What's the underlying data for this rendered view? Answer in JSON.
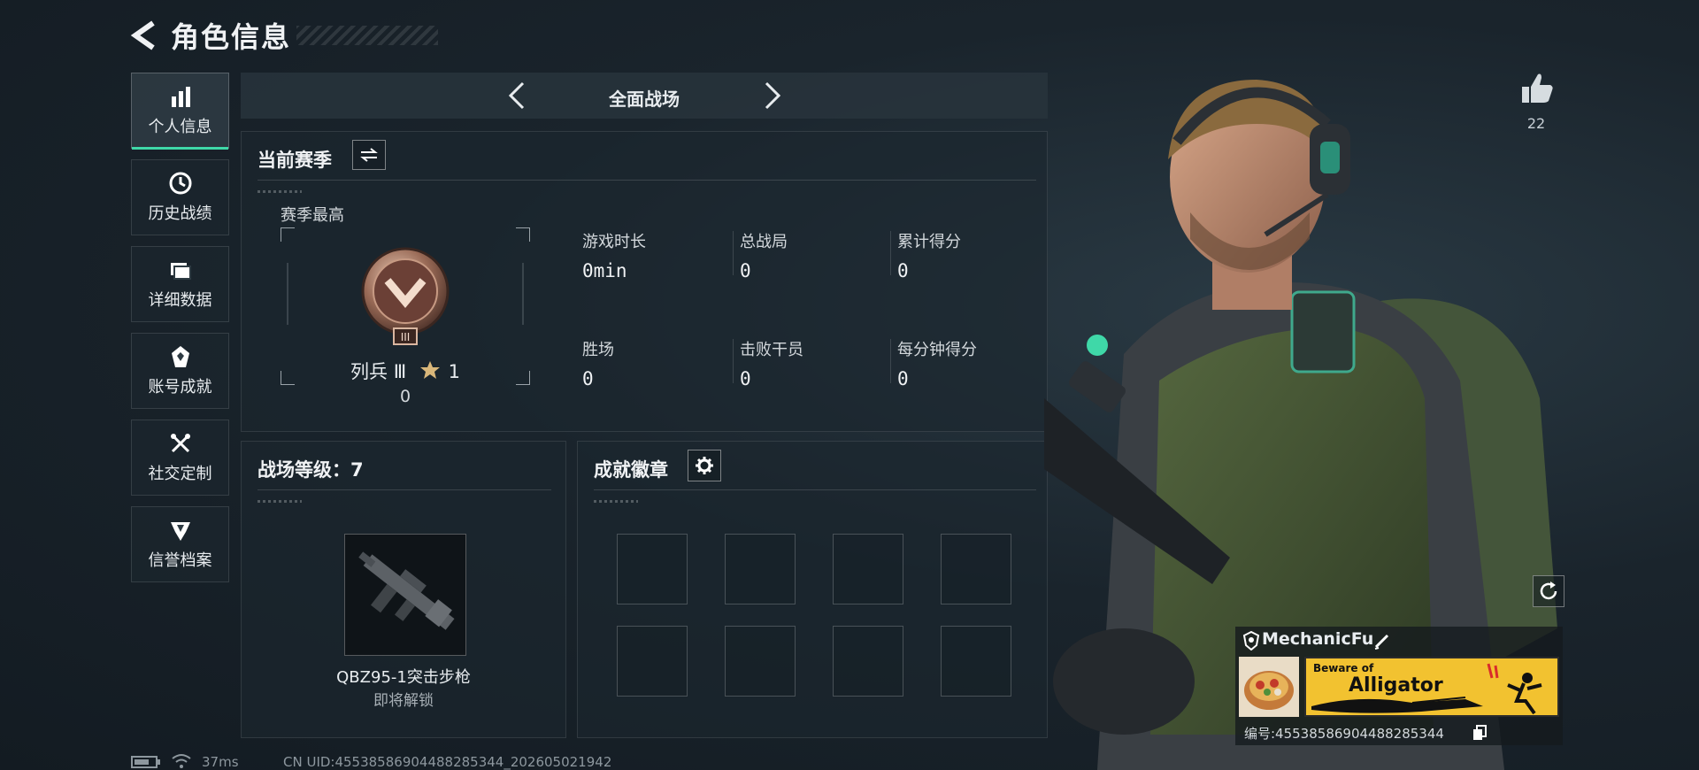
{
  "header": {
    "title": "角色信息"
  },
  "sidebar": {
    "items": [
      {
        "label": "个人信息",
        "icon": "bar-chart-icon",
        "active": true
      },
      {
        "label": "历史战绩",
        "icon": "clock-badge-icon",
        "active": false
      },
      {
        "label": "详细数据",
        "icon": "folder-icon",
        "active": false
      },
      {
        "label": "账号成就",
        "icon": "trophy-icon",
        "active": false
      },
      {
        "label": "社交定制",
        "icon": "tools-icon",
        "active": false
      },
      {
        "label": "信誉档案",
        "icon": "shield-emblem-icon",
        "active": false
      }
    ]
  },
  "mode": {
    "label": "全面战场"
  },
  "season": {
    "title": "当前赛季",
    "best_label": "赛季最高",
    "rank_name": "列兵 Ⅲ",
    "rank_stars": "1",
    "rank_points": "0",
    "stats": [
      {
        "label": "游戏时长",
        "value": "0min"
      },
      {
        "label": "总战局",
        "value": "0"
      },
      {
        "label": "累计得分",
        "value": "0"
      },
      {
        "label": "胜场",
        "value": "0"
      },
      {
        "label": "击败干员",
        "value": "0"
      },
      {
        "label": "每分钟得分",
        "value": "0"
      }
    ]
  },
  "level": {
    "title": "战场等级：7",
    "weapon_name": "QBZ95-1突击步枪",
    "weapon_status": "即将解锁"
  },
  "badges": {
    "title": "成就徽章",
    "slots": 8
  },
  "profile": {
    "likes": "22",
    "player_name": "MechanicFu",
    "banner_line1": "Beware of",
    "banner_line2": "Alligator",
    "player_id": "编号:4553858690448828534​4"
  },
  "status_bar": {
    "ping": "37ms",
    "uid": "CN UID:4553858690448828534​4_202605021942"
  },
  "colors": {
    "accent": "#3fd8a8",
    "banner": "#f2c230",
    "bg": "#1a242c"
  }
}
